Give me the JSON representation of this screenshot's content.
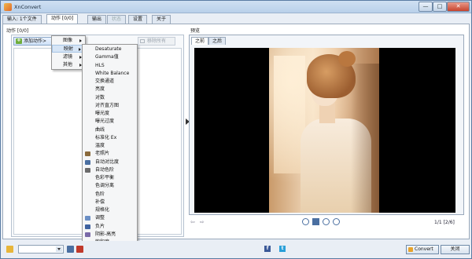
{
  "window": {
    "title": "XnConvert",
    "min_glyph": "—",
    "max_glyph": "□",
    "close_glyph": "✕"
  },
  "tabs": [
    {
      "label": "输入: 1个文件"
    },
    {
      "label": "动作 [0/0]"
    },
    {
      "label": "输出"
    },
    {
      "label": "状态"
    },
    {
      "label": "设置"
    },
    {
      "label": "关于"
    }
  ],
  "actions": {
    "label": "动作 [0/0]",
    "add_button": "添加动作>",
    "remove_all": "移除所有"
  },
  "preview": {
    "label": "预览",
    "tabs": [
      "之前",
      "之后"
    ],
    "page_info": "1/1 [2/6]"
  },
  "menu_level1": [
    {
      "label": "图像",
      "has_submenu": true
    },
    {
      "label": "映射",
      "has_submenu": true,
      "highlighted": true
    },
    {
      "label": "滤镜",
      "has_submenu": true
    },
    {
      "label": "其他",
      "has_submenu": true
    }
  ],
  "menu_level2": [
    {
      "label": "Desaturate",
      "icon": ""
    },
    {
      "label": "Gamma值",
      "icon": ""
    },
    {
      "label": "HLS",
      "icon": ""
    },
    {
      "label": "White Balance",
      "icon": ""
    },
    {
      "label": "交换通道",
      "icon": ""
    },
    {
      "label": "亮度",
      "icon": ""
    },
    {
      "label": "对数",
      "icon": ""
    },
    {
      "label": "对齐直方图",
      "icon": ""
    },
    {
      "label": "曝光度",
      "icon": ""
    },
    {
      "label": "曝光过度",
      "icon": ""
    },
    {
      "label": "曲线",
      "icon": ""
    },
    {
      "label": "标准化 Ex",
      "icon": ""
    },
    {
      "label": "温度",
      "icon": ""
    },
    {
      "label": "老照片",
      "icon": "old-photo-icon"
    },
    {
      "label": "自动对比度",
      "icon": "auto-contrast-icon"
    },
    {
      "label": "自动色阶",
      "icon": "auto-levels-icon"
    },
    {
      "label": "色彩平衡",
      "icon": ""
    },
    {
      "label": "色调分离",
      "icon": ""
    },
    {
      "label": "色阶",
      "icon": ""
    },
    {
      "label": "补偿",
      "icon": ""
    },
    {
      "label": "规格化",
      "icon": ""
    },
    {
      "label": "调整",
      "icon": "adjust-icon"
    },
    {
      "label": "负片",
      "icon": "negative-icon"
    },
    {
      "label": "阴影-高亮",
      "icon": "shadow-highlight-icon"
    },
    {
      "label": "饱和度",
      "icon": ""
    },
    {
      "label": "黑/白点",
      "icon": ""
    }
  ],
  "bottom": {
    "convert_label": "Convert",
    "close_label": "关闭",
    "facebook": "f",
    "twitter": "t"
  },
  "colors": {
    "accent": "#4a6fa1",
    "facebook": "#3b5998",
    "twitter": "#2a9fd8"
  }
}
